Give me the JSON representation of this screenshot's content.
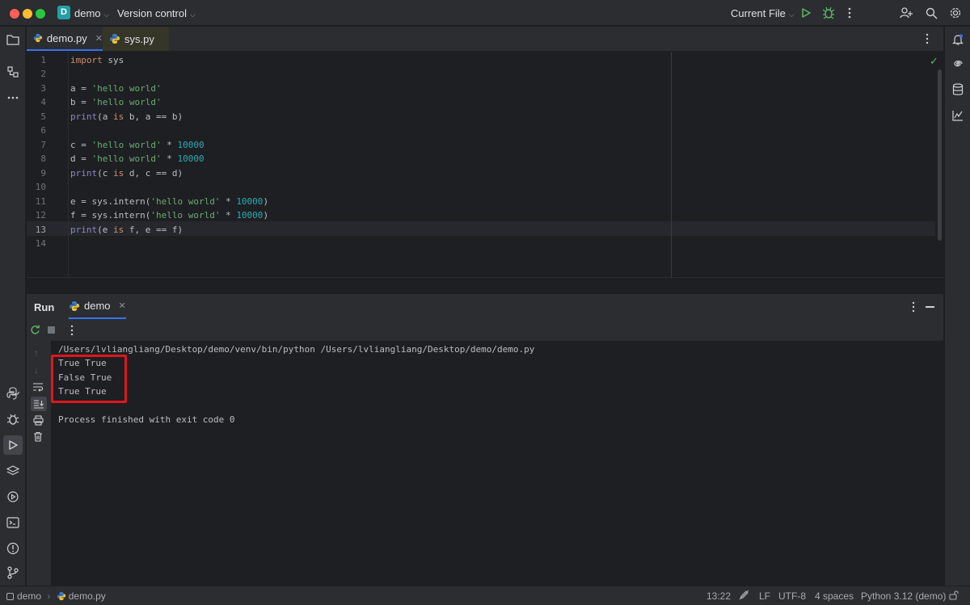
{
  "titlebar": {
    "project_badge": "D",
    "project_name": "demo",
    "vcs": "Version control",
    "run_config": "Current File"
  },
  "tabs": [
    {
      "label": "demo.py",
      "active": true
    },
    {
      "label": "sys.py",
      "active": false
    }
  ],
  "editor": {
    "line_numbers": [
      "1",
      "2",
      "3",
      "4",
      "5",
      "6",
      "7",
      "8",
      "9",
      "10",
      "11",
      "12",
      "13",
      "14"
    ],
    "current_line": "13"
  },
  "code_tokens": {
    "l1_kw": "import",
    "l1_rest": " sys",
    "l3_a": "a = ",
    "l3_s": "'hello world'",
    "l4_a": "b = ",
    "l4_s": "'hello world'",
    "l5_print": "print",
    "l5_a": "(a ",
    "l5_is": "is",
    "l5_b": " b, a == b)",
    "l7_a": "c = ",
    "l7_s": "'hello world'",
    "l7_op": " * ",
    "l7_n": "10000",
    "l8_a": "d = ",
    "l8_s": "'hello world'",
    "l8_op": " * ",
    "l8_n": "10000",
    "l9_print": "print",
    "l9_a": "(c ",
    "l9_is": "is",
    "l9_b": " d, c == d)",
    "l11_a": "e = sys.intern(",
    "l11_s": "'hello world'",
    "l11_op": " * ",
    "l11_n": "10000",
    "l11_c": ")",
    "l12_a": "f = sys.intern(",
    "l12_s": "'hello world'",
    "l12_op": " * ",
    "l12_n": "10000",
    "l12_c": ")",
    "l13_print": "print",
    "l13_a": "(e ",
    "l13_is": "is",
    "l13_b": " f, e == f)"
  },
  "run": {
    "title": "Run",
    "tab_label": "demo",
    "console_lines": [
      "/Users/lvliangliang/Desktop/demo/venv/bin/python /Users/lvliangliang/Desktop/demo/demo.py",
      "True True",
      "False True",
      "True True",
      "",
      "Process finished with exit code 0"
    ]
  },
  "status": {
    "breadcrumb_project": "demo",
    "breadcrumb_file": "demo.py",
    "position": "13:22",
    "line_sep": "LF",
    "encoding": "UTF-8",
    "indent": "4 spaces",
    "interpreter": "Python 3.12 (demo)"
  },
  "colors": {
    "accent": "#3574f0",
    "highlight": "#e0161d",
    "run_green": "#5fb865"
  }
}
